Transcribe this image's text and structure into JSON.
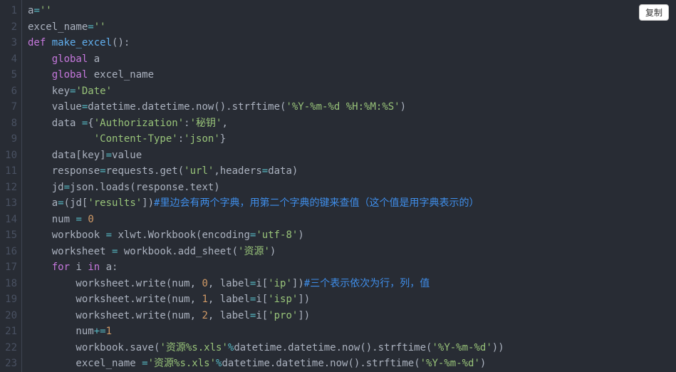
{
  "copy_button": "复制",
  "lines": [
    "1",
    "2",
    "3",
    "4",
    "5",
    "6",
    "7",
    "8",
    "9",
    "10",
    "11",
    "12",
    "13",
    "14",
    "15",
    "16",
    "17",
    "18",
    "19",
    "20",
    "21",
    "22",
    "23"
  ],
  "chart_data": {
    "type": "table",
    "language": "python",
    "tokens": [
      [
        {
          "t": "a",
          "c": "plain"
        },
        {
          "t": "=",
          "c": "op"
        },
        {
          "t": "''",
          "c": "str"
        }
      ],
      [
        {
          "t": "excel_name",
          "c": "plain"
        },
        {
          "t": "=",
          "c": "op"
        },
        {
          "t": "''",
          "c": "str"
        }
      ],
      [
        {
          "t": "def",
          "c": "kw"
        },
        {
          "t": " ",
          "c": "plain"
        },
        {
          "t": "make_excel",
          "c": "fn"
        },
        {
          "t": "():",
          "c": "punc"
        }
      ],
      [
        {
          "t": "    ",
          "c": "plain"
        },
        {
          "t": "global",
          "c": "kw"
        },
        {
          "t": " a",
          "c": "plain"
        }
      ],
      [
        {
          "t": "    ",
          "c": "plain"
        },
        {
          "t": "global",
          "c": "kw"
        },
        {
          "t": " excel_name",
          "c": "plain"
        }
      ],
      [
        {
          "t": "    key",
          "c": "plain"
        },
        {
          "t": "=",
          "c": "op"
        },
        {
          "t": "'Date'",
          "c": "str"
        }
      ],
      [
        {
          "t": "    value",
          "c": "plain"
        },
        {
          "t": "=",
          "c": "op"
        },
        {
          "t": "datetime.datetime.now().strftime(",
          "c": "plain"
        },
        {
          "t": "'%Y-%m-%d %H:%M:%S'",
          "c": "str"
        },
        {
          "t": ")",
          "c": "punc"
        }
      ],
      [
        {
          "t": "    data ",
          "c": "plain"
        },
        {
          "t": "=",
          "c": "op"
        },
        {
          "t": "{",
          "c": "punc"
        },
        {
          "t": "'Authorization'",
          "c": "str"
        },
        {
          "t": ":",
          "c": "punc"
        },
        {
          "t": "'秘钥'",
          "c": "str"
        },
        {
          "t": ",",
          "c": "punc"
        }
      ],
      [
        {
          "t": "           ",
          "c": "plain"
        },
        {
          "t": "'Content-Type'",
          "c": "str"
        },
        {
          "t": ":",
          "c": "punc"
        },
        {
          "t": "'json'",
          "c": "str"
        },
        {
          "t": "}",
          "c": "punc"
        }
      ],
      [
        {
          "t": "    data[key]",
          "c": "plain"
        },
        {
          "t": "=",
          "c": "op"
        },
        {
          "t": "value",
          "c": "plain"
        }
      ],
      [
        {
          "t": "    response",
          "c": "plain"
        },
        {
          "t": "=",
          "c": "op"
        },
        {
          "t": "requests.get(",
          "c": "plain"
        },
        {
          "t": "'url'",
          "c": "str"
        },
        {
          "t": ",headers",
          "c": "plain"
        },
        {
          "t": "=",
          "c": "op"
        },
        {
          "t": "data)",
          "c": "plain"
        }
      ],
      [
        {
          "t": "    jd",
          "c": "plain"
        },
        {
          "t": "=",
          "c": "op"
        },
        {
          "t": "json.loads(response.text)",
          "c": "plain"
        }
      ],
      [
        {
          "t": "    a",
          "c": "plain"
        },
        {
          "t": "=",
          "c": "op"
        },
        {
          "t": "(jd[",
          "c": "plain"
        },
        {
          "t": "'results'",
          "c": "str"
        },
        {
          "t": "])",
          "c": "punc"
        },
        {
          "t": "#里边会有两个字典，用第二个字典的键来查值（这个值是用字典表示的）",
          "c": "cmt"
        }
      ],
      [
        {
          "t": "    num ",
          "c": "plain"
        },
        {
          "t": "=",
          "c": "op"
        },
        {
          "t": " ",
          "c": "plain"
        },
        {
          "t": "0",
          "c": "num"
        }
      ],
      [
        {
          "t": "    workbook ",
          "c": "plain"
        },
        {
          "t": "=",
          "c": "op"
        },
        {
          "t": " xlwt.Workbook(encoding",
          "c": "plain"
        },
        {
          "t": "=",
          "c": "op"
        },
        {
          "t": "'utf-8'",
          "c": "str"
        },
        {
          "t": ")",
          "c": "punc"
        }
      ],
      [
        {
          "t": "    worksheet ",
          "c": "plain"
        },
        {
          "t": "=",
          "c": "op"
        },
        {
          "t": " workbook.add_sheet(",
          "c": "plain"
        },
        {
          "t": "'资源'",
          "c": "str"
        },
        {
          "t": ")",
          "c": "punc"
        }
      ],
      [
        {
          "t": "    ",
          "c": "plain"
        },
        {
          "t": "for",
          "c": "kw"
        },
        {
          "t": " i ",
          "c": "plain"
        },
        {
          "t": "in",
          "c": "kw"
        },
        {
          "t": " a:",
          "c": "plain"
        }
      ],
      [
        {
          "t": "        worksheet.write(num, ",
          "c": "plain"
        },
        {
          "t": "0",
          "c": "num"
        },
        {
          "t": ", label",
          "c": "plain"
        },
        {
          "t": "=",
          "c": "op"
        },
        {
          "t": "i[",
          "c": "plain"
        },
        {
          "t": "'ip'",
          "c": "str"
        },
        {
          "t": "])",
          "c": "punc"
        },
        {
          "t": "#三个表示依次为行，列，值",
          "c": "cmt"
        }
      ],
      [
        {
          "t": "        worksheet.write(num, ",
          "c": "plain"
        },
        {
          "t": "1",
          "c": "num"
        },
        {
          "t": ", label",
          "c": "plain"
        },
        {
          "t": "=",
          "c": "op"
        },
        {
          "t": "i[",
          "c": "plain"
        },
        {
          "t": "'isp'",
          "c": "str"
        },
        {
          "t": "])",
          "c": "punc"
        }
      ],
      [
        {
          "t": "        worksheet.write(num, ",
          "c": "plain"
        },
        {
          "t": "2",
          "c": "num"
        },
        {
          "t": ", label",
          "c": "plain"
        },
        {
          "t": "=",
          "c": "op"
        },
        {
          "t": "i[",
          "c": "plain"
        },
        {
          "t": "'pro'",
          "c": "str"
        },
        {
          "t": "])",
          "c": "punc"
        }
      ],
      [
        {
          "t": "        num",
          "c": "plain"
        },
        {
          "t": "+=",
          "c": "op"
        },
        {
          "t": "1",
          "c": "num"
        }
      ],
      [
        {
          "t": "        workbook.save(",
          "c": "plain"
        },
        {
          "t": "'资源%s.xls'",
          "c": "str"
        },
        {
          "t": "%",
          "c": "op"
        },
        {
          "t": "datetime.datetime.now().strftime(",
          "c": "plain"
        },
        {
          "t": "'%Y-%m-%d'",
          "c": "str"
        },
        {
          "t": "))",
          "c": "punc"
        }
      ],
      [
        {
          "t": "        excel_name ",
          "c": "plain"
        },
        {
          "t": "=",
          "c": "op"
        },
        {
          "t": "'资源%s.xls'",
          "c": "str"
        },
        {
          "t": "%",
          "c": "op"
        },
        {
          "t": "datetime.datetime.now().strftime(",
          "c": "plain"
        },
        {
          "t": "'%Y-%m-%d'",
          "c": "str"
        },
        {
          "t": ")",
          "c": "punc"
        }
      ]
    ]
  }
}
